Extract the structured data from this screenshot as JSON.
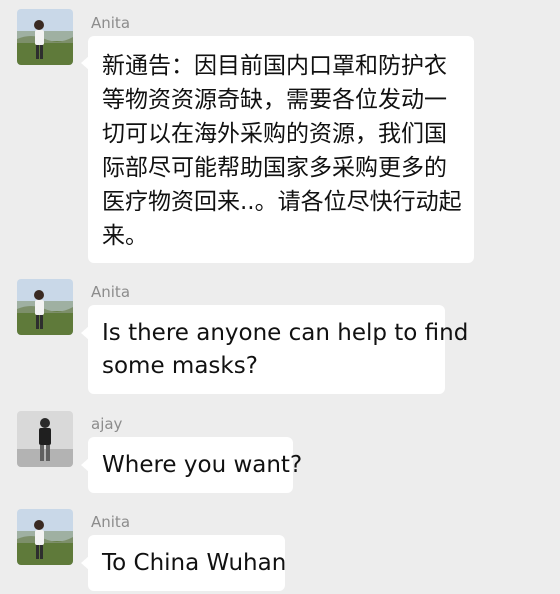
{
  "colors": {
    "background": "#ededed",
    "bubble": "#ffffff",
    "sender_name": "#8c8c8c",
    "message_text": "#111111"
  },
  "messages": [
    {
      "sender": "Anita",
      "avatar": "anita-avatar-photo",
      "lines": [
        "新通告：因目前国内口罩和防护衣",
        "等物资资源奇缺，需要各位发动一",
        "切可以在海外采购的资源，我们国",
        "际部尽可能帮助国家多采购更多的",
        "医疗物资回来..。请各位尽快行动起",
        "来。"
      ]
    },
    {
      "sender": "Anita",
      "avatar": "anita-avatar-photo",
      "lines": [
        "Is there anyone can help to find",
        "some masks?"
      ]
    },
    {
      "sender": "ajay",
      "avatar": "ajay-avatar-photo",
      "lines": [
        "Where you want?"
      ]
    },
    {
      "sender": "Anita",
      "avatar": "anita-avatar-photo",
      "lines": [
        "To China Wuhan"
      ]
    }
  ]
}
